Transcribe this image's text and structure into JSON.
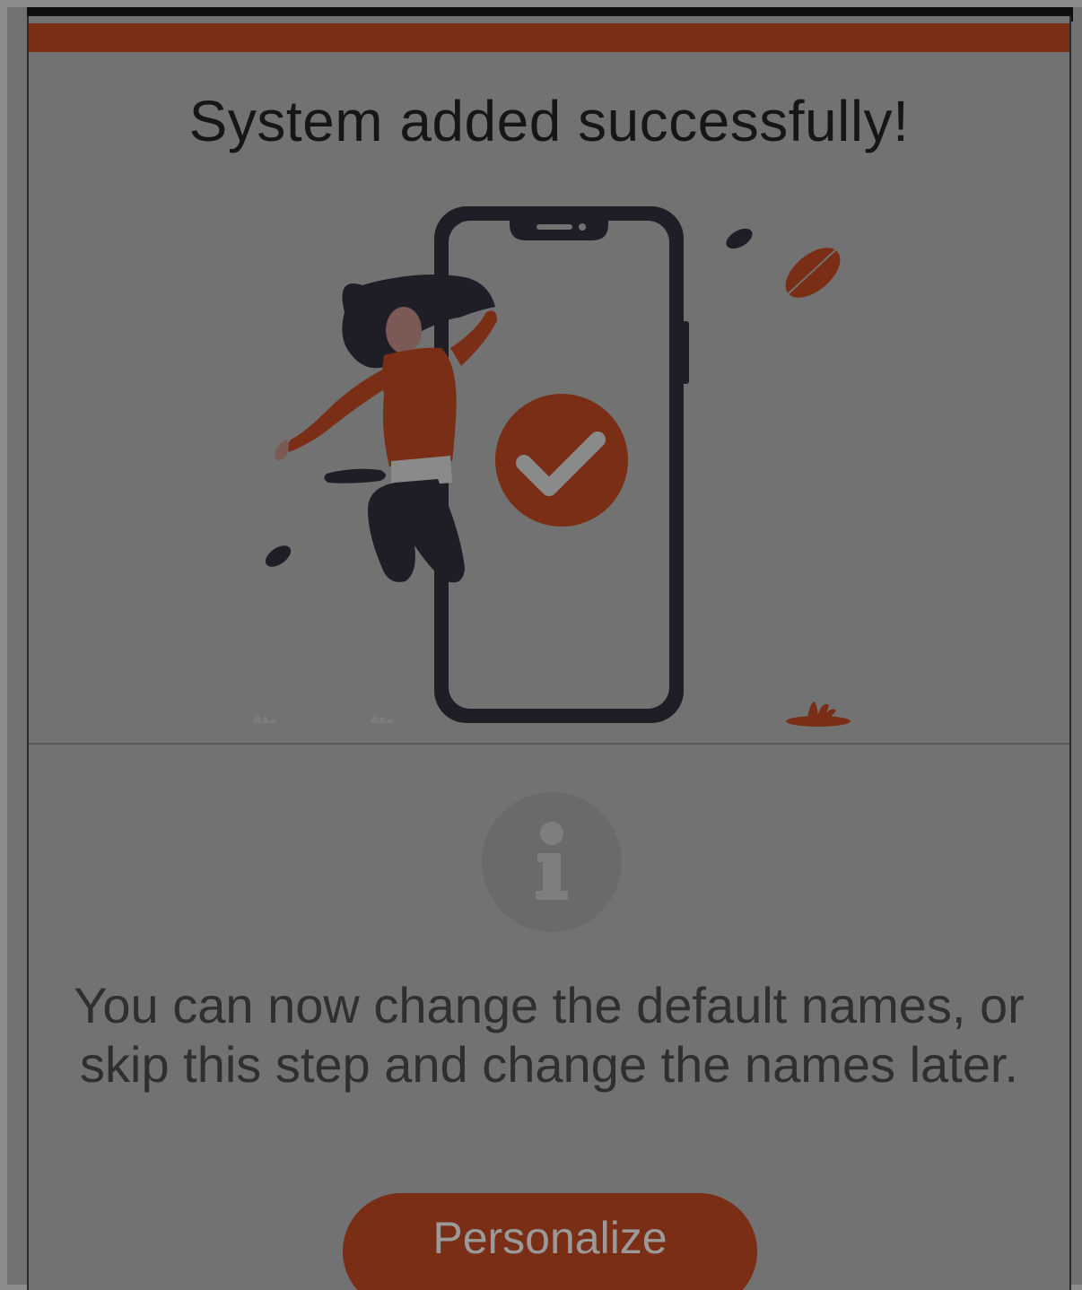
{
  "dialog": {
    "title": "System added successfully!",
    "message_line1": "You can now change the default names, or",
    "message_line2": "skip this step and change the names later.",
    "personalize_label": "Personalize"
  },
  "icons": {
    "illustration": "phone-checkmark-illustration",
    "info": "info-icon",
    "checkmark": "checkmark-icon"
  },
  "colors": {
    "accent": "#7a2e16",
    "overlay": "#727272",
    "phone_outline": "#1f1e27",
    "text_title": "#161616",
    "text_body": "#2f2f2f"
  }
}
